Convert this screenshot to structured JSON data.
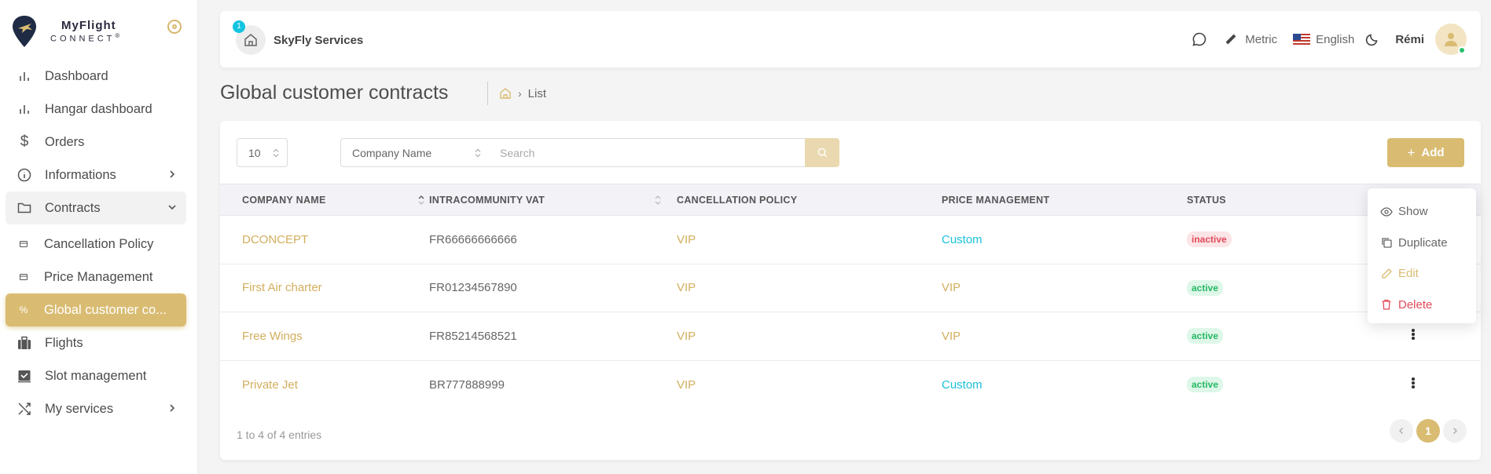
{
  "sidebar": {
    "logo": {
      "line1": "MyFlight",
      "line2": "CONNECT",
      "mark": "®"
    },
    "items": [
      {
        "label": "Dashboard",
        "icon": "bar-chart-icon"
      },
      {
        "label": "Hangar dashboard",
        "icon": "bar-chart-icon"
      },
      {
        "label": "Orders",
        "icon": "dollar-icon"
      },
      {
        "label": "Informations",
        "icon": "info-icon"
      },
      {
        "label": "Contracts",
        "icon": "folder-icon"
      },
      {
        "label": "Cancellation Policy",
        "icon": "card-icon"
      },
      {
        "label": "Price Management",
        "icon": "card-icon"
      },
      {
        "label": "Global customer co...",
        "icon": "percent-icon"
      },
      {
        "label": "Flights",
        "icon": "luggage-icon"
      },
      {
        "label": "Slot management",
        "icon": "calendar-check-icon"
      },
      {
        "label": "My services",
        "icon": "shuffle-icon"
      }
    ]
  },
  "topbar": {
    "company_badge": "1",
    "company_name": "SkyFly Services",
    "units": "Metric",
    "language": "English",
    "user": "Rémi"
  },
  "page": {
    "title": "Global customer contracts",
    "breadcrumb_current": "List"
  },
  "toolbar": {
    "page_size": "10",
    "filter_field": "Company Name",
    "search_placeholder": "Search",
    "add_label": "Add"
  },
  "table": {
    "columns": [
      "COMPANY NAME",
      "INTRACOMMUNITY VAT",
      "CANCELLATION POLICY",
      "PRICE MANAGEMENT",
      "STATUS"
    ],
    "rows": [
      {
        "company": "DCONCEPT",
        "vat": "FR66666666666",
        "cancellation": "VIP",
        "price": "Custom",
        "status": "inactive"
      },
      {
        "company": "First Air charter",
        "vat": "FR01234567890",
        "cancellation": "VIP",
        "price": "VIP",
        "status": "active"
      },
      {
        "company": "Free Wings",
        "vat": "FR85214568521",
        "cancellation": "VIP",
        "price": "VIP",
        "status": "active"
      },
      {
        "company": "Private Jet",
        "vat": "BR777888999",
        "cancellation": "VIP",
        "price": "Custom",
        "status": "active"
      }
    ]
  },
  "footer": {
    "info": "1 to 4 of 4 entries",
    "current_page": "1"
  },
  "menu": {
    "show": "Show",
    "duplicate": "Duplicate",
    "edit": "Edit",
    "delete": "Delete"
  },
  "colors": {
    "accent": "#d9bc72",
    "cyan": "#1ac1db",
    "active": "#25b862",
    "inactive": "#e14a5b"
  }
}
